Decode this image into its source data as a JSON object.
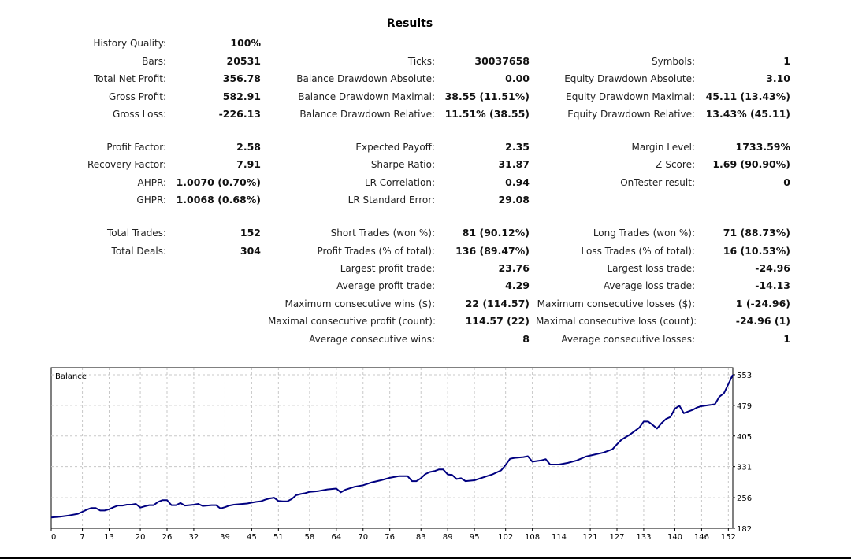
{
  "title": "Results",
  "stats": [
    {
      "row": 0,
      "items": [
        {
          "col": 1,
          "label": "History Quality:",
          "value": "100%"
        }
      ]
    },
    {
      "row": 1,
      "items": [
        {
          "col": 1,
          "label": "Bars:",
          "value": "20531"
        },
        {
          "col": 2,
          "label": "Ticks:",
          "value": "30037658"
        },
        {
          "col": 3,
          "label": "Symbols:",
          "value": "1"
        }
      ]
    },
    {
      "row": 2,
      "items": [
        {
          "col": 1,
          "label": "Total Net Profit:",
          "value": "356.78"
        },
        {
          "col": 2,
          "label": "Balance Drawdown Absolute:",
          "value": "0.00"
        },
        {
          "col": 3,
          "label": "Equity Drawdown Absolute:",
          "value": "3.10"
        }
      ]
    },
    {
      "row": 3,
      "items": [
        {
          "col": 1,
          "label": "Gross Profit:",
          "value": "582.91"
        },
        {
          "col": 2,
          "label": "Balance Drawdown Maximal:",
          "value": "38.55 (11.51%)"
        },
        {
          "col": 3,
          "label": "Equity Drawdown Maximal:",
          "value": "45.11 (13.43%)"
        }
      ]
    },
    {
      "row": 4,
      "items": [
        {
          "col": 1,
          "label": "Gross Loss:",
          "value": "-226.13"
        },
        {
          "col": 2,
          "label": "Balance Drawdown Relative:",
          "value": "11.51% (38.55)"
        },
        {
          "col": 3,
          "label": "Equity Drawdown Relative:",
          "value": "13.43% (45.11)"
        }
      ]
    },
    {
      "row": 5,
      "items": [
        {
          "col": 1,
          "label": "Profit Factor:",
          "value": "2.58"
        },
        {
          "col": 2,
          "label": "Expected Payoff:",
          "value": "2.35"
        },
        {
          "col": 3,
          "label": "Margin Level:",
          "value": "1733.59%"
        }
      ]
    },
    {
      "row": 6,
      "items": [
        {
          "col": 1,
          "label": "Recovery Factor:",
          "value": "7.91"
        },
        {
          "col": 2,
          "label": "Sharpe Ratio:",
          "value": "31.87"
        },
        {
          "col": 3,
          "label": "Z-Score:",
          "value": "1.69 (90.90%)"
        }
      ]
    },
    {
      "row": 7,
      "items": [
        {
          "col": 1,
          "label": "AHPR:",
          "value": "1.0070 (0.70%)"
        },
        {
          "col": 2,
          "label": "LR Correlation:",
          "value": "0.94"
        },
        {
          "col": 3,
          "label": "OnTester result:",
          "value": "0"
        }
      ]
    },
    {
      "row": 8,
      "items": [
        {
          "col": 1,
          "label": "GHPR:",
          "value": "1.0068 (0.68%)"
        },
        {
          "col": 2,
          "label": "LR Standard Error:",
          "value": "29.08"
        }
      ]
    },
    {
      "row": 9,
      "items": [
        {
          "col": 1,
          "label": "Total Trades:",
          "value": "152"
        },
        {
          "col": 2,
          "label": "Short Trades (won %):",
          "value": "81 (90.12%)"
        },
        {
          "col": 3,
          "label": "Long Trades (won %):",
          "value": "71 (88.73%)"
        }
      ]
    },
    {
      "row": 10,
      "items": [
        {
          "col": 1,
          "label": "Total Deals:",
          "value": "304"
        },
        {
          "col": 2,
          "label": "Profit Trades (% of total):",
          "value": "136 (89.47%)"
        },
        {
          "col": 3,
          "label": "Loss Trades (% of total):",
          "value": "16 (10.53%)"
        }
      ]
    },
    {
      "row": 11,
      "items": [
        {
          "col": 2,
          "label": "Largest profit trade:",
          "value": "23.76"
        },
        {
          "col": 3,
          "label": "Largest loss trade:",
          "value": "-24.96"
        }
      ]
    },
    {
      "row": 12,
      "items": [
        {
          "col": 2,
          "label": "Average profit trade:",
          "value": "4.29"
        },
        {
          "col": 3,
          "label": "Average loss trade:",
          "value": "-14.13"
        }
      ]
    },
    {
      "row": 13,
      "items": [
        {
          "col": 2,
          "label": "Maximum consecutive wins ($):",
          "value": "22 (114.57)"
        },
        {
          "col": 3,
          "label": "Maximum consecutive losses ($):",
          "value": "1 (-24.96)"
        }
      ]
    },
    {
      "row": 14,
      "items": [
        {
          "col": 2,
          "label": "Maximal consecutive profit (count):",
          "value": "114.57 (22)"
        },
        {
          "col": 3,
          "label": "Maximal consecutive loss (count):",
          "value": "-24.96 (1)"
        }
      ]
    },
    {
      "row": 15,
      "items": [
        {
          "col": 2,
          "label": "Average consecutive wins:",
          "value": "8"
        },
        {
          "col": 3,
          "label": "Average consecutive losses:",
          "value": "1"
        }
      ]
    }
  ],
  "chart_data": {
    "type": "line",
    "title": "Balance",
    "xlabel": "",
    "ylabel": "",
    "xlim": [
      0,
      153
    ],
    "ylim": [
      182,
      570
    ],
    "x_ticks": [
      0,
      7,
      13,
      20,
      26,
      32,
      39,
      45,
      51,
      58,
      64,
      70,
      76,
      83,
      89,
      95,
      102,
      108,
      114,
      121,
      127,
      133,
      140,
      146,
      152
    ],
    "y_ticks": [
      182,
      256,
      331,
      405,
      479,
      553
    ],
    "grid": true,
    "line_color": "#000080",
    "series": [
      {
        "name": "Balance",
        "x": [
          0,
          2,
          4,
          6,
          7,
          8,
          9,
          10,
          11,
          12,
          13,
          14,
          15,
          16,
          17,
          18,
          19,
          20,
          21,
          22,
          23,
          24,
          25,
          26,
          27,
          28,
          29,
          30,
          31,
          32,
          33,
          34,
          35,
          36,
          37,
          38,
          39,
          40,
          41,
          42,
          43,
          44,
          45,
          46,
          47,
          48,
          49,
          50,
          51,
          52,
          53,
          54,
          55,
          56,
          57,
          58,
          60,
          62,
          64,
          65,
          66,
          68,
          70,
          72,
          74,
          76,
          78,
          80,
          81,
          82,
          83,
          84,
          85,
          86,
          87,
          88,
          89,
          90,
          91,
          92,
          93,
          95,
          97,
          99,
          101,
          102,
          103,
          104,
          106,
          107,
          108,
          110,
          111,
          112,
          114,
          116,
          118,
          120,
          122,
          124,
          125,
          126,
          127,
          128,
          130,
          131,
          132,
          133,
          134,
          135,
          136,
          137,
          138,
          139,
          140,
          141,
          142,
          144,
          145,
          146,
          148,
          149,
          150,
          151,
          152,
          153
        ],
        "y": [
          208,
          210,
          213,
          217,
          222,
          227,
          231,
          231,
          225,
          225,
          228,
          233,
          237,
          237,
          239,
          239,
          241,
          232,
          235,
          238,
          238,
          246,
          250,
          250,
          238,
          238,
          243,
          237,
          238,
          239,
          241,
          236,
          237,
          238,
          238,
          230,
          233,
          237,
          239,
          240,
          241,
          242,
          244,
          246,
          247,
          251,
          254,
          256,
          248,
          247,
          247,
          253,
          262,
          265,
          267,
          270,
          272,
          276,
          278,
          269,
          275,
          282,
          286,
          293,
          298,
          304,
          308,
          308,
          296,
          296,
          303,
          313,
          318,
          320,
          324,
          324,
          312,
          311,
          301,
          303,
          296,
          298,
          305,
          312,
          322,
          335,
          350,
          352,
          354,
          356,
          343,
          346,
          349,
          336,
          336,
          340,
          346,
          355,
          360,
          365,
          369,
          373,
          385,
          396,
          409,
          417,
          425,
          440,
          440,
          432,
          423,
          436,
          446,
          451,
          471,
          478,
          460,
          468,
          474,
          477,
          480,
          482,
          500,
          508,
          530,
          553
        ]
      }
    ]
  }
}
